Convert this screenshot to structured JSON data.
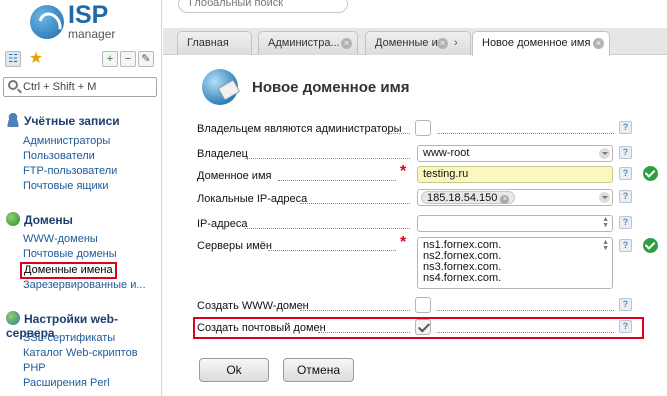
{
  "app": {
    "logo_brand": "ISP",
    "logo_sub": "manager",
    "global_search_placeholder": "Глобальный поиск"
  },
  "sidebar": {
    "search_placeholder": "Ctrl + Shift + M",
    "sections": [
      {
        "title": "Учётные записи",
        "icon": "users-icon",
        "items": [
          "Администраторы",
          "Пользователи",
          "FTP-пользователи",
          "Почтовые ящики"
        ]
      },
      {
        "title": "Домены",
        "icon": "globe-icon",
        "items": [
          "WWW-домены",
          "Почтовые домены",
          "Доменные имена",
          "Зарезервированные и..."
        ]
      },
      {
        "title": "Настройки web-сервера",
        "icon": "web-settings-icon",
        "items": [
          "SSL-сертификаты",
          "Каталог Web-скриптов",
          "PHP",
          "Расширения Perl"
        ]
      }
    ],
    "selected_item": "Доменные имена"
  },
  "tabs": [
    {
      "label": "Главная",
      "closable": false
    },
    {
      "label": "Администра...",
      "closable": true
    },
    {
      "label": "Доменные и...",
      "closable": true
    },
    {
      "label": "Новое доменное имя",
      "closable": true,
      "active": true
    }
  ],
  "form": {
    "title": "Новое доменное имя",
    "fields": {
      "owners_admins": {
        "label": "Владельцем являются администраторы",
        "checked": false
      },
      "owner": {
        "label": "Владелец",
        "value": "www-root"
      },
      "domain_name": {
        "label": "Доменное имя",
        "value": "testing.ru",
        "required": true,
        "valid": true
      },
      "local_ips": {
        "label": "Локальные IP-адреса",
        "value": "185.18.54.150"
      },
      "ip_addresses": {
        "label": "IP-адреса",
        "value": ""
      },
      "name_servers": {
        "label": "Серверы имён",
        "required": true,
        "valid": true,
        "values": [
          "ns1.fornex.com.",
          "ns2.fornex.com.",
          "ns3.fornex.com.",
          "ns4.fornex.com."
        ]
      },
      "create_www": {
        "label": "Создать WWW-домен",
        "checked": false
      },
      "create_mail": {
        "label": "Создать почтовый домен",
        "checked": true
      }
    },
    "help_glyph": "?",
    "ok_label": "Ok",
    "cancel_label": "Отмена"
  },
  "colors": {
    "accent": "#1f6aa8",
    "highlight": "#e0001b",
    "valid": "#2ea043",
    "required_field_bg": "#fbf8bf"
  }
}
